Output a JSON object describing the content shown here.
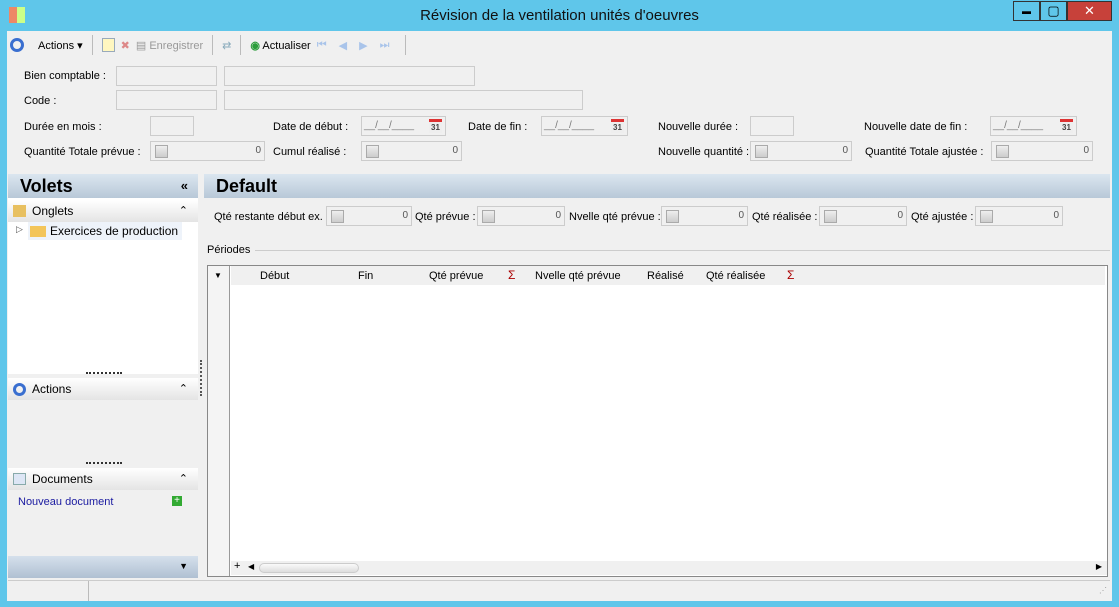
{
  "window": {
    "title": "Révision de la ventilation unités d'oeuvres",
    "minimize": "▬",
    "maximize": "▢",
    "close": "✕"
  },
  "toolbar": {
    "actions": "Actions",
    "save": "Enregistrer",
    "refresh": "Actualiser"
  },
  "form": {
    "bien_comptable": "Bien comptable :",
    "code": "Code :",
    "duree_mois": "Durée en mois :",
    "date_debut": "Date de début :",
    "date_fin": "Date de fin :",
    "nouvelle_duree": "Nouvelle durée :",
    "nouvelle_date_fin": "Nouvelle date de fin :",
    "qte_totale_prevue": "Quantité Totale prévue :",
    "cumul_realise": "Cumul réalisé :",
    "nouvelle_quantite": "Nouvelle quantité :",
    "qte_totale_ajustee": "Quantité Totale ajustée :",
    "date_placeholder": "__/__/____",
    "calendar": "31",
    "zero": "0"
  },
  "left": {
    "title": "Volets",
    "collapse": "«",
    "onglets": "Onglets",
    "tree_item": "Exercices de production",
    "actions": "Actions",
    "documents": "Documents",
    "new_doc": "Nouveau document",
    "expand": "⌃"
  },
  "main": {
    "title": "Default",
    "qte_restante": "Qté restante début ex. :",
    "qte_prevue": "Qté prévue :",
    "nvelle_qte_prevue": "Nvelle qté prévue :",
    "qte_realisee": "Qté réalisée :",
    "qte_ajustee": "Qté ajustée :",
    "zero": "0",
    "periodes": "Périodes"
  },
  "grid": {
    "columns": [
      "Début",
      "Fin",
      "Qté prévue",
      "Nvelle qté prévue",
      "Réalisé",
      "Qté réalisée"
    ],
    "sigma": "Σ"
  }
}
